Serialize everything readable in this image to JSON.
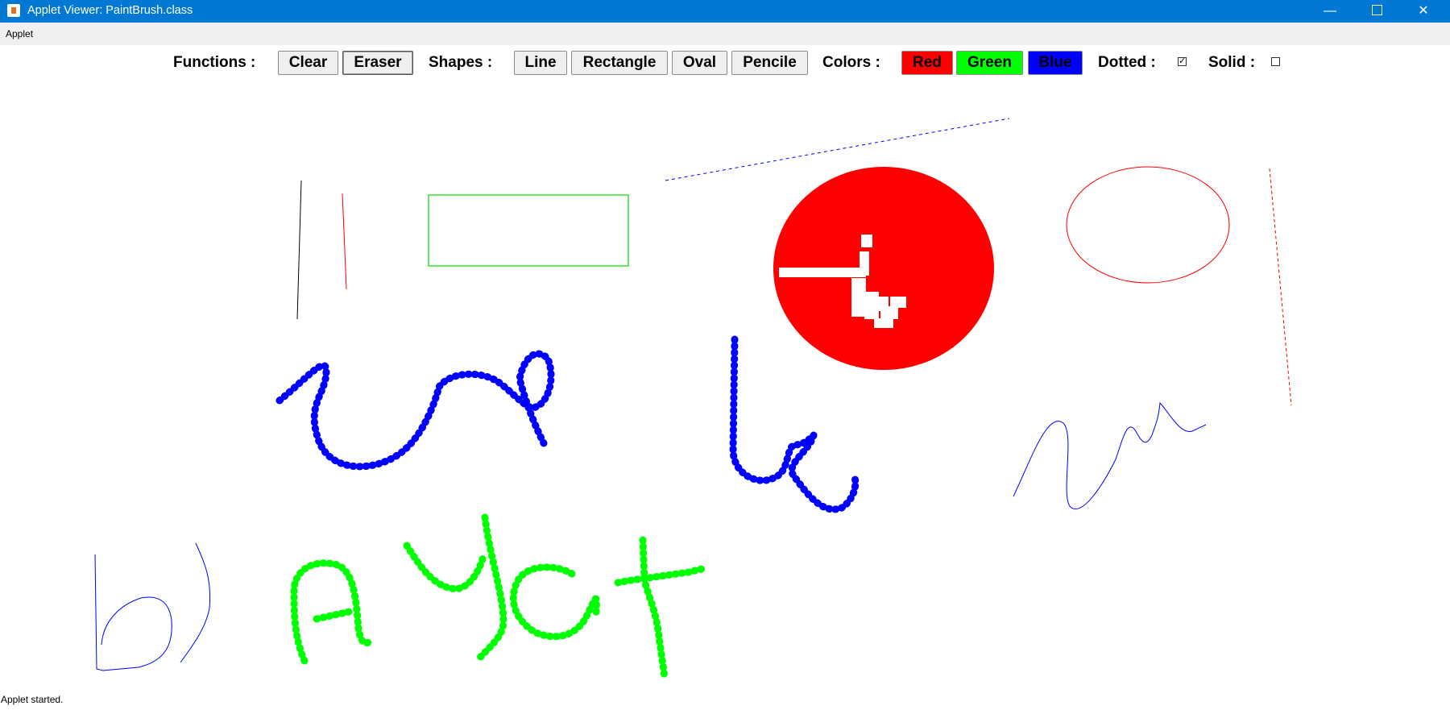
{
  "window": {
    "title": "Applet Viewer: PaintBrush.class",
    "minimize_glyph": "—",
    "close_glyph": "✕"
  },
  "menubar": {
    "applet": "Applet"
  },
  "toolbar": {
    "functions_label": "Functions :",
    "clear": "Clear",
    "eraser": "Eraser",
    "shapes_label": "Shapes :",
    "line": "Line",
    "rectangle": "Rectangle",
    "oval": "Oval",
    "pencil": "Pencile",
    "colors_label": "Colors :",
    "red": "Red",
    "green": "Green",
    "blue": "Blue",
    "dotted_label": "Dotted :",
    "dotted_checked": true,
    "solid_label": "Solid :",
    "solid_checked": false
  },
  "colors": {
    "titlebar": "#0078d4",
    "red": "#ff0000",
    "green": "#00ff00",
    "blue": "#0000ff"
  },
  "status": "Applet started."
}
